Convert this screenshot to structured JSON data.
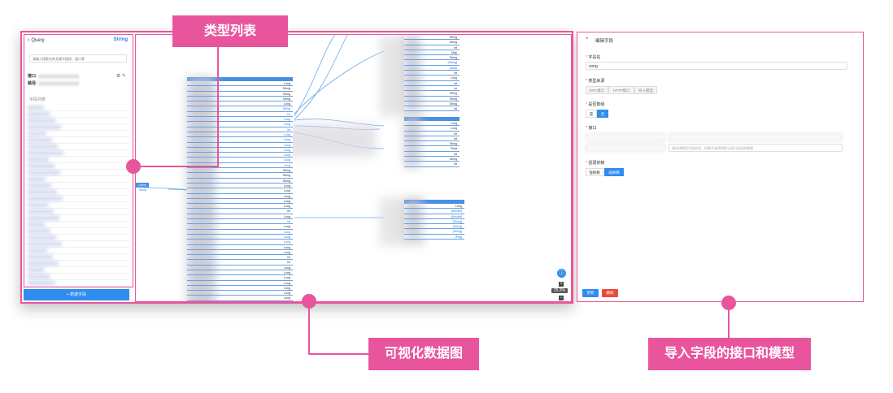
{
  "left_panel": {
    "back_label": "Query",
    "type_label": "String",
    "search_placeholder": "请输入搜索名称关键字描述、接口等",
    "interface_label": "接口",
    "path_label": "路径",
    "field_list_label": "字段列表",
    "add_field_label": "+ 新建字段"
  },
  "graph": {
    "main_table_rows": [
      "Long",
      "String",
      "String",
      "String",
      "Long",
      "String",
      "Int",
      "Long",
      "Long",
      "Int",
      "Long",
      "Long",
      "Long",
      "Long",
      "Long",
      "Long",
      "Long",
      "String",
      "String",
      "String",
      "Long",
      "Long",
      "Long",
      "Long",
      "Long",
      "Int",
      "Long",
      "Int",
      "Long",
      "Long",
      "Long",
      "Long",
      "Long",
      "Long",
      "Int",
      "Int",
      "Long",
      "Long",
      "Long",
      "Long",
      "Long",
      "Long",
      "Long",
      "Int",
      "Long",
      "Long",
      "Long",
      "Long"
    ],
    "top_table_rows": [
      "String",
      "String",
      "Int",
      "Map",
      "String",
      "[String]",
      "[Map]",
      "Int",
      "Long",
      "Int",
      "Int",
      "String",
      "String",
      "String",
      "Int"
    ],
    "mid_table_rows": [
      "Long",
      "Long",
      "Int",
      "Int",
      "String",
      "Float",
      "Int",
      "String",
      "Int"
    ],
    "bot_table_rows": [
      "Long",
      "[Abcdef]",
      "[Abcdef]",
      "[String]",
      "[String]",
      "[String]",
      "[Pkg]"
    ],
    "small_node_label": "Query",
    "small_node_type": "String",
    "zoom_level": "25.2%"
  },
  "edit_panel": {
    "title": "编辑字段",
    "field_name_label": "字段名",
    "field_name_value": "song",
    "type_source_label": "类型来源",
    "type_source_options": [
      "RPC接口",
      "HTTP接口",
      "导入模型"
    ],
    "is_array_label": "是否数组",
    "is_array_options": [
      "是",
      "否"
    ],
    "interface_label": "接口",
    "interface_hint": "请选择模型字段信息，如果不选择则默认接口返回的数据",
    "strong_weak_label": "强弱依赖",
    "strong_weak_options": [
      "强依赖",
      "弱依赖"
    ],
    "save_label": "更新",
    "delete_label": "删除"
  },
  "callouts": {
    "type_list": "类型列表",
    "visual_graph": "可视化数据图",
    "import_field": "导入字段的接口和模型"
  },
  "colors": {
    "accent": "#e9559d",
    "primary": "#2f8cf0",
    "danger": "#e74c3c"
  }
}
